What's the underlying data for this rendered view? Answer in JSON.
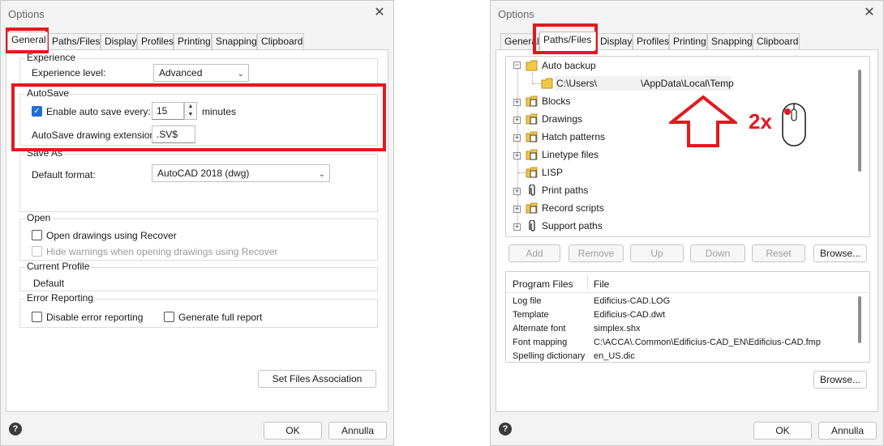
{
  "left_dialog": {
    "title": "Options",
    "tabs": [
      "General",
      "Paths/Files",
      "Display",
      "Profiles",
      "Printing",
      "Snapping",
      "Clipboard"
    ],
    "active_tab": "General",
    "experience": {
      "group_title": "Experience",
      "level_label": "Experience level:",
      "level_value": "Advanced"
    },
    "autosave": {
      "group_title": "AutoSave",
      "enable_label": "Enable auto save every:",
      "enabled": true,
      "interval_value": "15",
      "interval_unit": "minutes",
      "extension_label": "AutoSave drawing extension:",
      "extension_value": ".SV$"
    },
    "save_as": {
      "group_title": "Save As",
      "format_label": "Default format:",
      "format_value": "AutoCAD 2018 (dwg)"
    },
    "open": {
      "group_title": "Open",
      "recover_label": "Open drawings using Recover",
      "hide_warnings_label": "Hide warnings when opening drawings using Recover"
    },
    "current_profile": {
      "group_title": "Current Profile",
      "value": "Default"
    },
    "error_reporting": {
      "group_title": "Error Reporting",
      "disable_label": "Disable error reporting",
      "full_report_label": "Generate full report"
    },
    "set_files_association_label": "Set Files Association",
    "ok_label": "OK",
    "cancel_label": "Annulla",
    "help_label": "?"
  },
  "right_dialog": {
    "title": "Options",
    "tabs": [
      "General",
      "Paths/Files",
      "Display",
      "Profiles",
      "Printing",
      "Snapping",
      "Clipboard"
    ],
    "active_tab": "Paths/Files",
    "tree": {
      "auto_backup": "Auto backup",
      "auto_backup_path_a": "C:\\Users\\",
      "auto_backup_path_b": "\\AppData\\Local\\Temp",
      "items": [
        "Blocks",
        "Drawings",
        "Hatch patterns",
        "Linetype files",
        "LISP",
        "Print paths",
        "Record scripts",
        "Support paths"
      ]
    },
    "buttons": {
      "add": "Add",
      "remove": "Remove",
      "up": "Up",
      "down": "Down",
      "reset": "Reset",
      "browse": "Browse...",
      "browse2": "Browse..."
    },
    "program_files": {
      "col1": "Program Files",
      "col2": "File",
      "rows": [
        {
          "name": "Log file",
          "value": "Edificius-CAD.LOG"
        },
        {
          "name": "Template",
          "value": "Edificius-CAD.dwt"
        },
        {
          "name": "Alternate font",
          "value": "simplex.shx"
        },
        {
          "name": "Font mapping",
          "value": "C:\\ACCA\\.Common\\Edificius-CAD_EN\\Edificius-CAD.fmp"
        },
        {
          "name": "Spelling dictionary",
          "value": "en_US.dic"
        }
      ]
    },
    "annotation_text": "2x",
    "ok_label": "OK",
    "cancel_label": "Annulla",
    "help_label": "?"
  },
  "colors": {
    "highlight_red": "#e3191f",
    "checkbox_blue": "#1f6ed4",
    "folder_yellow": "#f2c744"
  }
}
